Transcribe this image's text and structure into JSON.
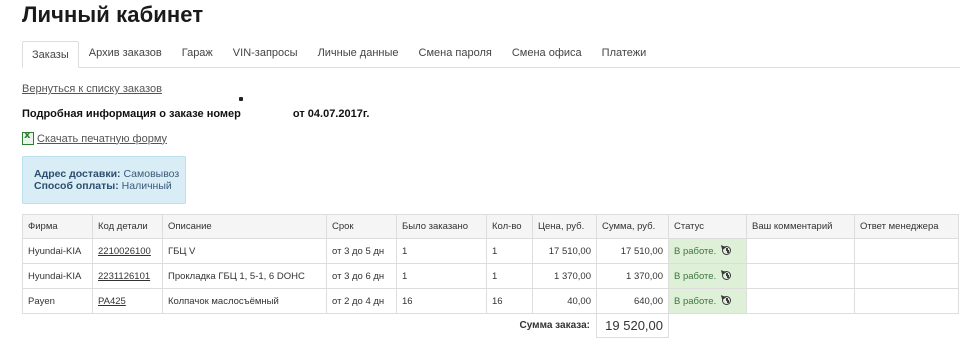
{
  "page": {
    "title": "Личный кабинет"
  },
  "tabs": [
    {
      "label": "Заказы",
      "active": true
    },
    {
      "label": "Архив заказов",
      "active": false
    },
    {
      "label": "Гараж",
      "active": false
    },
    {
      "label": "VIN-запросы",
      "active": false
    },
    {
      "label": "Личные данные",
      "active": false
    },
    {
      "label": "Смена пароля",
      "active": false
    },
    {
      "label": "Смена офиса",
      "active": false
    },
    {
      "label": "Платежи",
      "active": false
    }
  ],
  "back_link": "Вернуться к списку заказов",
  "order": {
    "heading_prefix": "Подробная информация о заказе номер",
    "heading_suffix": "от 04.07.2017г.",
    "print_link": "Скачать печатную форму"
  },
  "delivery": {
    "address_label": "Адрес доставки:",
    "address_value": "Самовывоз",
    "payment_label": "Способ оплаты:",
    "payment_value": "Наличный"
  },
  "table": {
    "headers": [
      "Фирма",
      "Код детали",
      "Описание",
      "Срок",
      "Было заказано",
      "Кол-во",
      "Цена, руб.",
      "Сумма, руб.",
      "Статус",
      "Ваш комментарий",
      "Ответ менеджера"
    ],
    "rows": [
      {
        "brand": "Hyundai-KIA",
        "code": "2210026100",
        "desc": "ГБЦ V",
        "term": "от 3 до 5 дн",
        "ordered": "1",
        "qty": "1",
        "price": "17 510,00",
        "sum": "17 510,00",
        "status": "В работе.",
        "comment": "",
        "reply": ""
      },
      {
        "brand": "Hyundai-KIA",
        "code": "2231126101",
        "desc": "Прокладка ГБЦ 1, 5-1, 6 DOHC",
        "term": "от 3 до 6 дн",
        "ordered": "1",
        "qty": "1",
        "price": "1 370,00",
        "sum": "1 370,00",
        "status": "В работе.",
        "comment": "",
        "reply": ""
      },
      {
        "brand": "Payen",
        "code": "PA425",
        "desc": "Колпачок маслосъёмный",
        "term": "от 2 до 4 дн",
        "ordered": "16",
        "qty": "16",
        "price": "40,00",
        "sum": "640,00",
        "status": "В работе.",
        "comment": "",
        "reply": ""
      }
    ],
    "total_label": "Сумма заказа:",
    "total_value": "19 520,00"
  },
  "icons": {
    "status_history": "history-icon",
    "print_form": "excel-icon"
  },
  "colors": {
    "status_bg": "#dff0d8",
    "info_box_bg": "#d9edf7",
    "header_bg": "#f5f5f5"
  }
}
